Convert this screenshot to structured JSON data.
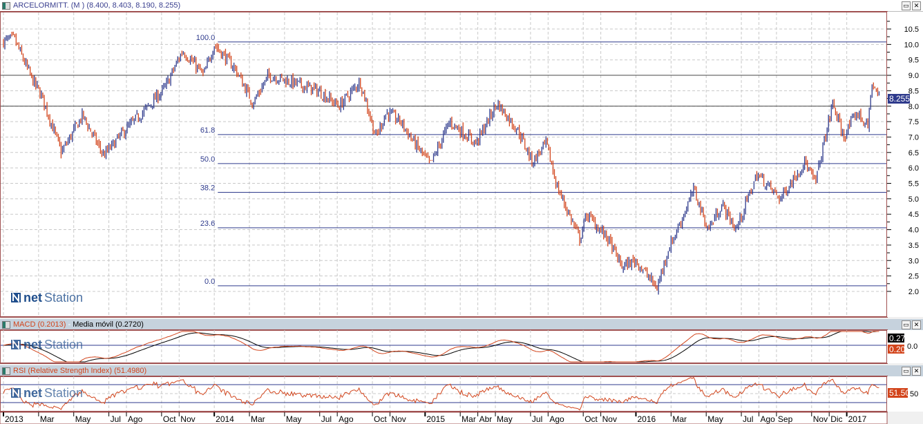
{
  "main": {
    "title": "ARCELORMITT. (M )",
    "ohlc_label": "(8.400, 8.403, 8.190, 8.255)",
    "last_price_label": "8.255",
    "logo_text": "netStation"
  },
  "macd": {
    "title": "MACD (0.2013)",
    "separator": " - ",
    "signal_title": "Media móvil (0.2720)",
    "signal_badge": "0.27",
    "macd_badge": "0.20",
    "zero_label": "0.0"
  },
  "rsi": {
    "title": "RSI (Relative Strength Index) (51.4980)",
    "badge": "51.50",
    "mid_label": "50"
  },
  "window_buttons": {
    "maximize": "▭",
    "close": "✕"
  },
  "colors": {
    "up": "#2e3a8c",
    "down": "#d2441b",
    "frame": "#a05050",
    "fib": "#2e3a8c",
    "header": "#c6d2dd"
  },
  "chart_data": {
    "type": "ohlc",
    "title": "ARCELORMITT. (M )",
    "x_unit": "months since Jan 2013",
    "ylim": [
      1.5,
      10.75
    ],
    "y_ticks": [
      2.0,
      2.5,
      3.0,
      3.5,
      4.0,
      4.5,
      5.0,
      5.5,
      6.0,
      6.5,
      7.0,
      7.5,
      8.0,
      8.5,
      9.0,
      9.5,
      10.0,
      10.5
    ],
    "x_ticks": [
      {
        "m": 0,
        "label": "2013",
        "major": true
      },
      {
        "m": 2,
        "label": "Mar"
      },
      {
        "m": 4,
        "label": "May"
      },
      {
        "m": 6,
        "label": "Jul"
      },
      {
        "m": 7,
        "label": "Ago"
      },
      {
        "m": 9,
        "label": "Oct"
      },
      {
        "m": 10,
        "label": "Nov"
      },
      {
        "m": 12,
        "label": "2014",
        "major": true
      },
      {
        "m": 14,
        "label": "Mar"
      },
      {
        "m": 16,
        "label": "May"
      },
      {
        "m": 18,
        "label": "Jul"
      },
      {
        "m": 19,
        "label": "Ago"
      },
      {
        "m": 21,
        "label": "Oct"
      },
      {
        "m": 22,
        "label": "Nov"
      },
      {
        "m": 24,
        "label": "2015",
        "major": true
      },
      {
        "m": 26,
        "label": "Mar"
      },
      {
        "m": 27,
        "label": "Abr"
      },
      {
        "m": 28,
        "label": "May"
      },
      {
        "m": 30,
        "label": "Jul"
      },
      {
        "m": 31,
        "label": "Ago"
      },
      {
        "m": 33,
        "label": "Oct"
      },
      {
        "m": 34,
        "label": "Nov"
      },
      {
        "m": 36,
        "label": "2016",
        "major": true
      },
      {
        "m": 38,
        "label": "Mar"
      },
      {
        "m": 40,
        "label": "May"
      },
      {
        "m": 42,
        "label": "Jul"
      },
      {
        "m": 43,
        "label": "Ago"
      },
      {
        "m": 44,
        "label": "Sep"
      },
      {
        "m": 46,
        "label": "Nov"
      },
      {
        "m": 47,
        "label": "Dic"
      },
      {
        "m": 48,
        "label": "2017",
        "major": true
      }
    ],
    "horizontal_lines": [
      9.0,
      8.0
    ],
    "fibonacci": {
      "start_m": 12.2,
      "levels": [
        {
          "label": "100.0",
          "price": 10.08
        },
        {
          "label": "61.8",
          "price": 7.08
        },
        {
          "label": "50.0",
          "price": 6.14
        },
        {
          "label": "38.2",
          "price": 5.21
        },
        {
          "label": "23.6",
          "price": 4.06
        },
        {
          "label": "0.0",
          "price": 2.18
        }
      ]
    },
    "approx_close_path": [
      [
        0,
        10.1
      ],
      [
        0.6,
        10.2
      ],
      [
        1.6,
        8.9
      ],
      [
        2.2,
        8.3
      ],
      [
        3.3,
        6.5
      ],
      [
        4.5,
        7.7
      ],
      [
        5.7,
        6.4
      ],
      [
        6.9,
        7.2
      ],
      [
        8.1,
        7.9
      ],
      [
        9.2,
        8.6
      ],
      [
        10.2,
        9.8
      ],
      [
        11.4,
        9.0
      ],
      [
        12.0,
        10.0
      ],
      [
        13.2,
        9.2
      ],
      [
        14.2,
        8.1
      ],
      [
        15.1,
        9.0
      ],
      [
        16.3,
        8.8
      ],
      [
        17.9,
        8.5
      ],
      [
        19.1,
        8.0
      ],
      [
        20.3,
        8.8
      ],
      [
        21.2,
        7.0
      ],
      [
        21.8,
        7.8
      ],
      [
        22.6,
        7.5
      ],
      [
        23.4,
        6.8
      ],
      [
        24.3,
        6.1
      ],
      [
        25.4,
        7.5
      ],
      [
        26.9,
        6.8
      ],
      [
        28.1,
        8.1
      ],
      [
        29.3,
        7.2
      ],
      [
        30.1,
        6.2
      ],
      [
        30.9,
        6.8
      ],
      [
        31.5,
        5.4
      ],
      [
        32.8,
        3.7
      ],
      [
        33.2,
        4.5
      ],
      [
        34.4,
        3.7
      ],
      [
        35.2,
        2.8
      ],
      [
        36.0,
        3.0
      ],
      [
        37.2,
        2.1
      ],
      [
        37.8,
        3.3
      ],
      [
        38.5,
        4.2
      ],
      [
        39.3,
        5.3
      ],
      [
        40.1,
        4.0
      ],
      [
        40.9,
        4.8
      ],
      [
        41.7,
        4.0
      ],
      [
        42.9,
        5.8
      ],
      [
        44.2,
        5.0
      ],
      [
        45.6,
        6.2
      ],
      [
        46.2,
        5.5
      ],
      [
        47.2,
        8.1
      ],
      [
        47.8,
        7.0
      ],
      [
        48.6,
        7.8
      ],
      [
        49.2,
        7.3
      ],
      [
        49.4,
        8.7
      ],
      [
        49.9,
        8.255
      ]
    ],
    "last": {
      "open": 8.4,
      "high": 8.403,
      "low": 8.19,
      "close": 8.255
    },
    "indicators": {
      "macd": {
        "value": 0.2013,
        "signal": 0.272,
        "signal_label": "Media móvil"
      },
      "rsi": {
        "value": 51.498,
        "levels": [
          30,
          50,
          70
        ]
      }
    }
  }
}
